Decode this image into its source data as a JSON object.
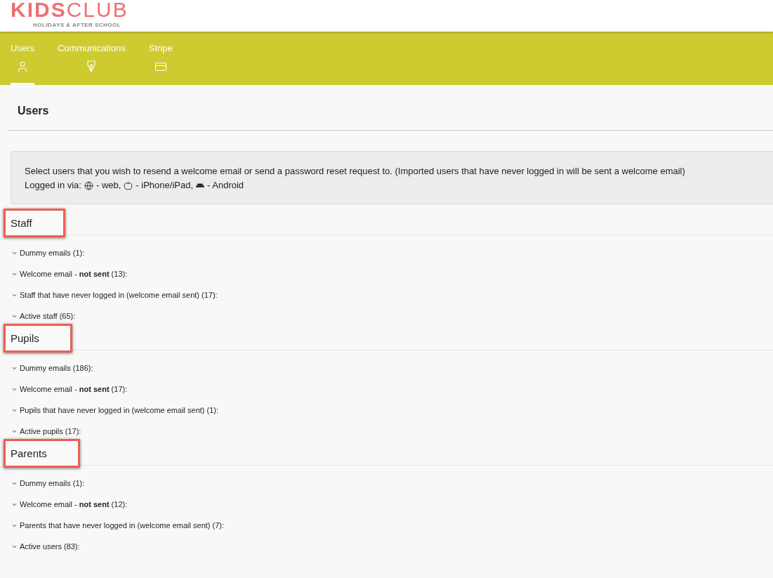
{
  "header": {
    "logo": {
      "primary": "KIDS",
      "secondary": "CLUB",
      "tagline": "HOLIDAYS & AFTER SCHOOL"
    }
  },
  "tabs": [
    {
      "label": "Users",
      "selected": true
    },
    {
      "label": "Communications",
      "selected": false
    },
    {
      "label": "Stripe",
      "selected": false
    }
  ],
  "page_title": "Users",
  "info": {
    "text": "Select users that you wish to resend a welcome email or send a password reset request to. (Imported users that have never logged in will be sent a welcome email)",
    "legend_label": "Logged in via:",
    "legend": [
      "- web,",
      "- iPhone/iPad,",
      "- Android"
    ]
  },
  "sections": [
    {
      "title": "Staff",
      "highlighted": true,
      "items": [
        "Dummy emails (1):",
        "Welcome email - **not sent** (13):",
        "Staff that have never logged in (welcome email sent) (17):",
        "Active staff (65):"
      ]
    },
    {
      "title": "Pupils",
      "highlighted": true,
      "items": [
        "Dummy emails (186):",
        "Welcome email - **not sent** (17):",
        "Pupils that have never logged in (welcome email sent) (1):",
        "Active pupils (17):"
      ]
    },
    {
      "title": "Parents",
      "highlighted": true,
      "items": [
        "Dummy emails (1):",
        "Welcome email - **not sent** (12):",
        "Parents that have never logged in (welcome email sent) (7):",
        "Active users (83):"
      ]
    }
  ]
}
